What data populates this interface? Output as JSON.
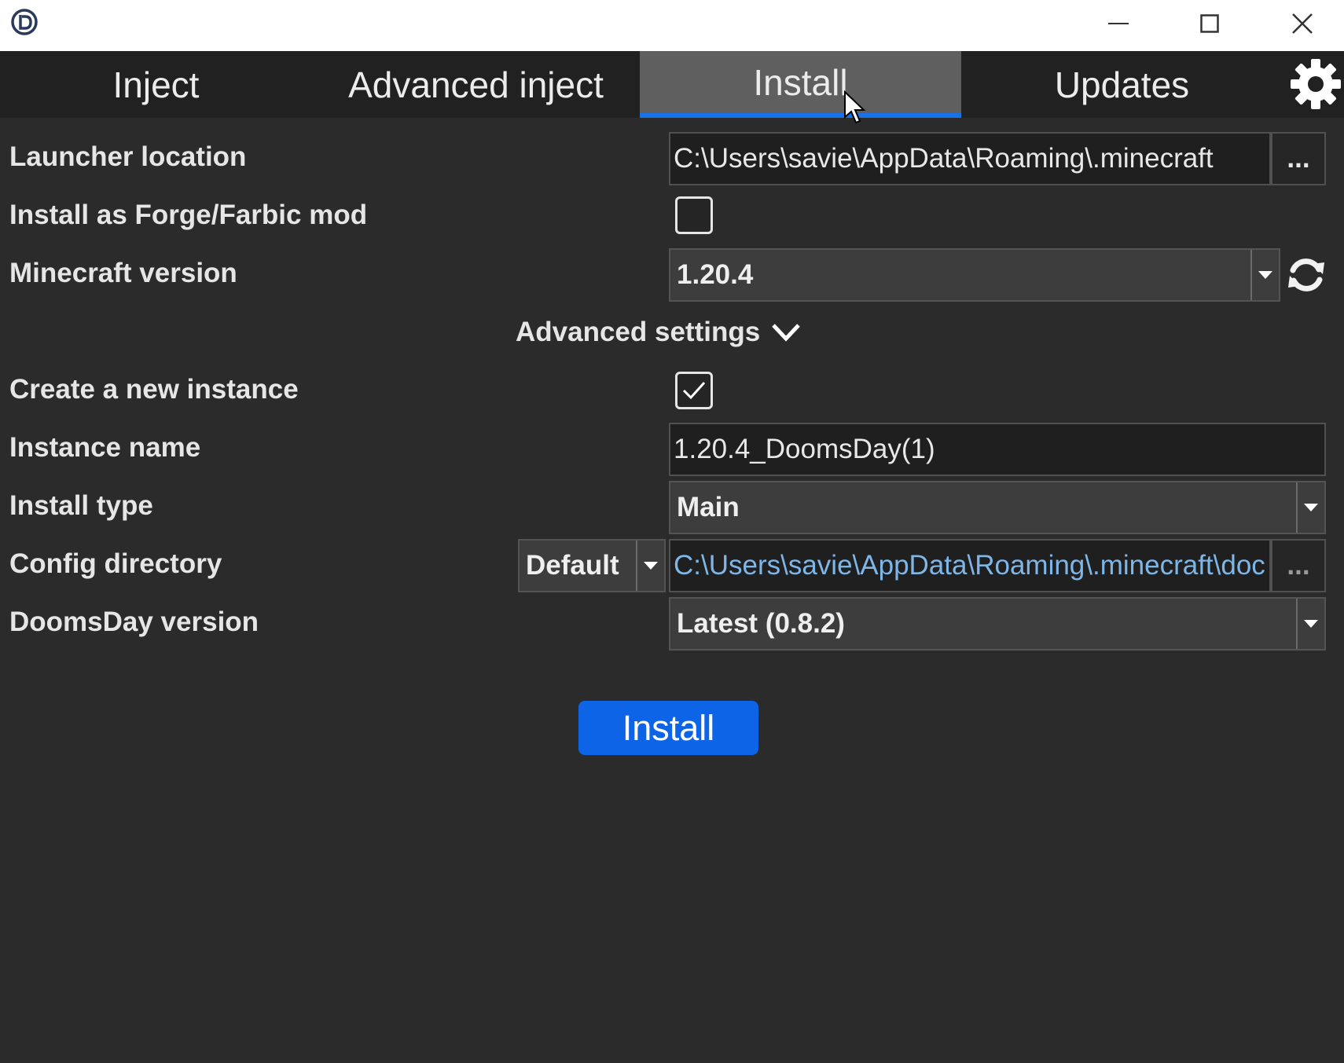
{
  "titlebar": {
    "minimize": "minimize-icon",
    "maximize": "maximize-icon",
    "close": "close-icon"
  },
  "tabs": [
    {
      "label": "Inject",
      "active": false
    },
    {
      "label": "Advanced inject",
      "active": false
    },
    {
      "label": "Install",
      "active": true
    },
    {
      "label": "Updates",
      "active": false
    }
  ],
  "form": {
    "launcher_location": {
      "label": "Launcher location",
      "value": "C:\\Users\\savie\\AppData\\Roaming\\.minecraft",
      "browse": "..."
    },
    "forge_mod": {
      "label": "Install as Forge/Farbic mod",
      "checked": false
    },
    "minecraft_version": {
      "label": "Minecraft version",
      "value": "1.20.4"
    },
    "advanced_settings": {
      "label": "Advanced settings"
    },
    "new_instance": {
      "label": "Create a new instance",
      "checked": true
    },
    "instance_name": {
      "label": "Instance name",
      "value": "1.20.4_DoomsDay(1)"
    },
    "install_type": {
      "label": "Install type",
      "value": "Main"
    },
    "config_directory": {
      "label": "Config directory",
      "mode": "Default",
      "value": "C:\\Users\\savie\\AppData\\Roaming\\.minecraft\\doc",
      "browse": "..."
    },
    "doomsday_version": {
      "label": "DoomsDay version",
      "value": "Latest (0.8.2)"
    }
  },
  "install_button": "Install",
  "colors": {
    "accent": "#0e64e6",
    "tab_underline": "#1672e6",
    "background": "#2b2b2b",
    "titlebar": "#ffffff"
  }
}
